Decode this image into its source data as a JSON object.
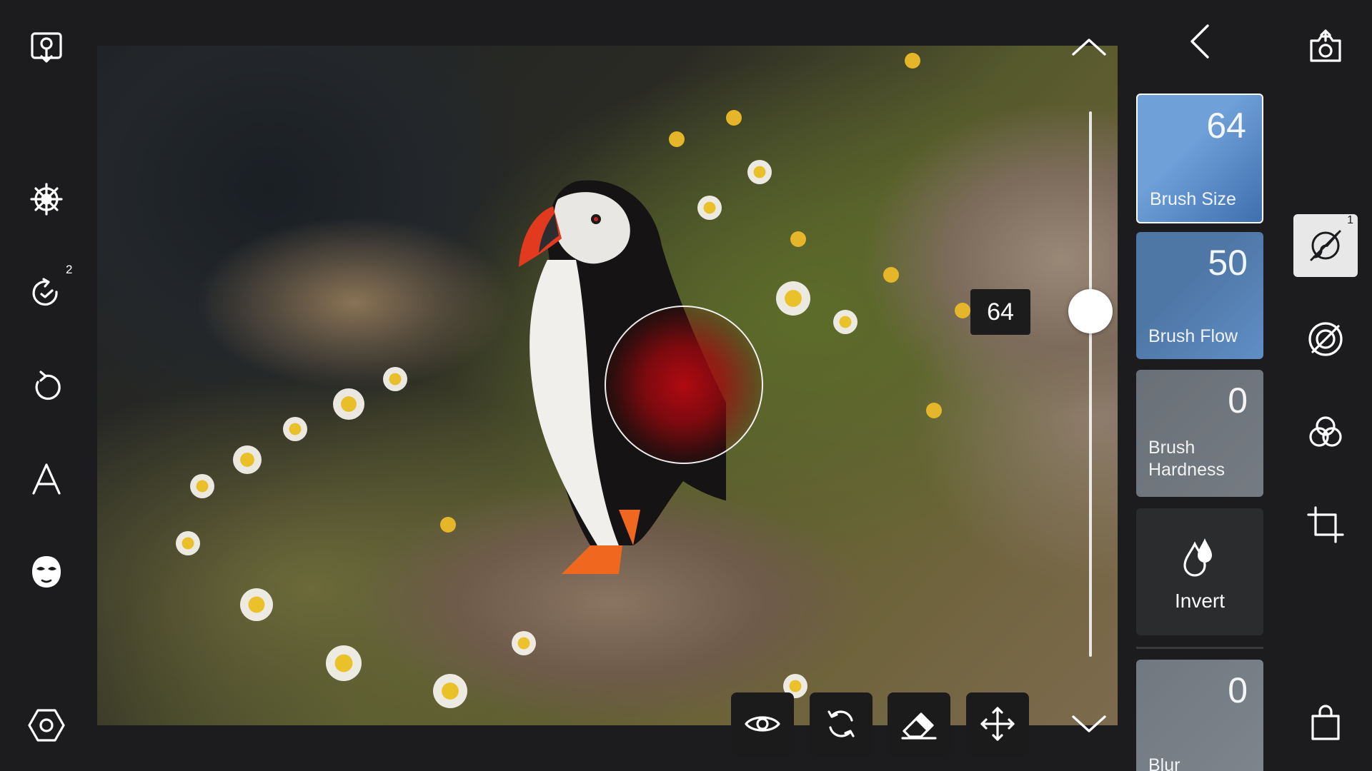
{
  "left_toolbar": {
    "looks_icon": "location-pin-icon",
    "tools_icon": "wheel-icon",
    "history_badge": "2",
    "reset_icon": "reset-icon",
    "text_icon": "letter-a-icon",
    "face_icon": "face-mask-icon",
    "settings_icon": "hexagon-settings-icon"
  },
  "canvas": {
    "brush_value_label": "64",
    "slider_value": 64
  },
  "panel": {
    "brush_size": {
      "value": "64",
      "label": "Brush Size"
    },
    "brush_flow": {
      "value": "50",
      "label": "Brush Flow"
    },
    "brush_hardness": {
      "value": "0",
      "label_line1": "Brush",
      "label_line2": "Hardness"
    },
    "invert": {
      "label": "Invert"
    },
    "blur": {
      "value": "0",
      "label": "Blur"
    }
  },
  "right_toolbar": {
    "brush_badge": "1"
  },
  "colors": {
    "background": "#1c1c1e",
    "card_active": "#5b8ec9",
    "card_blue": "#4a6f98",
    "card_gray": "#6b7179",
    "card_dark": "#2a2b2d",
    "mask_red": "#b90a12"
  }
}
